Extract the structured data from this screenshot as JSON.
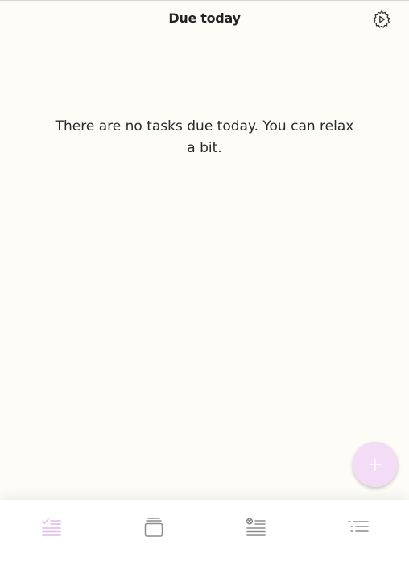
{
  "header": {
    "title": "Due today",
    "settings_icon": "gear-icon"
  },
  "main": {
    "empty_message": "There are no tasks due today. You can relax a bit."
  },
  "fab": {
    "icon": "plus-icon",
    "color": "#f3dcf5",
    "icon_color": "#ffffff"
  },
  "bottom_nav": {
    "active_color": "#e3b6ec",
    "inactive_color": "#8c8c8c",
    "items": [
      {
        "icon": "checklist-icon",
        "active": true
      },
      {
        "icon": "stacked-cards-icon",
        "active": false
      },
      {
        "icon": "cancelled-list-icon",
        "active": false
      },
      {
        "icon": "list-icon",
        "active": false
      }
    ]
  },
  "colors": {
    "background": "#fdfcf7",
    "text": "#222222"
  }
}
